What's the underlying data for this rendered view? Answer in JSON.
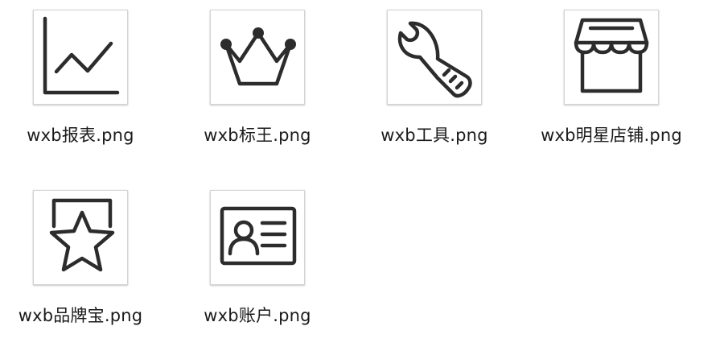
{
  "files": [
    {
      "name": "wxb报表.png",
      "icon": "line-chart-icon"
    },
    {
      "name": "wxb标王.png",
      "icon": "crown-icon"
    },
    {
      "name": "wxb工具.png",
      "icon": "wrench-icon"
    },
    {
      "name": "wxb明星店铺.png",
      "icon": "storefront-icon"
    },
    {
      "name": "wxb品牌宝.png",
      "icon": "star-badge-icon"
    },
    {
      "name": "wxb账户.png",
      "icon": "id-card-icon"
    }
  ],
  "colors": {
    "icon_stroke": "#2c2c2c",
    "label_text": "#1a1a1a"
  }
}
